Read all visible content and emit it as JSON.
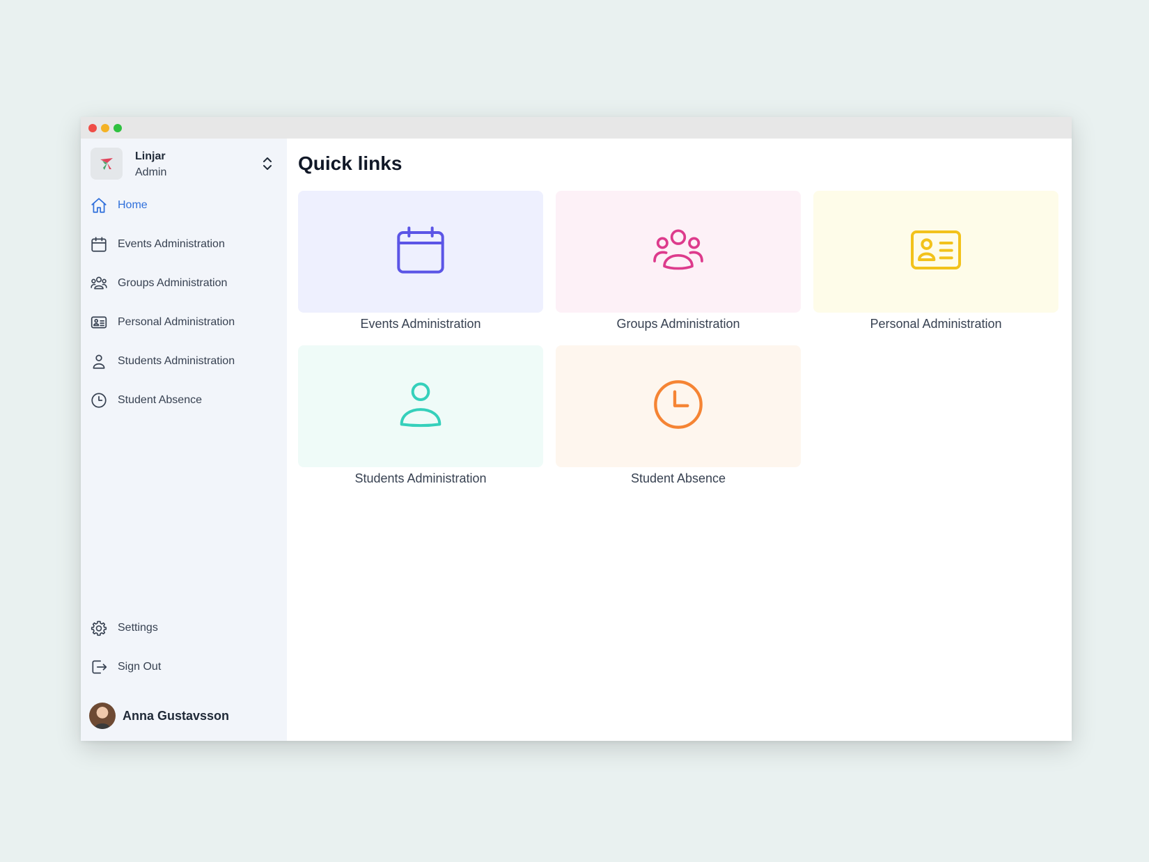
{
  "window": {
    "controls": [
      "close",
      "minimize",
      "maximize"
    ]
  },
  "sidebar": {
    "org": {
      "name": "Linjar",
      "role": "Admin",
      "logo_icon": "linjar-logo-icon",
      "switch_icon": "chevron-up-down-icon"
    },
    "items": [
      {
        "label": "Home",
        "icon": "home-icon",
        "active": true
      },
      {
        "label": "Events Administration",
        "icon": "calendar-icon",
        "active": false
      },
      {
        "label": "Groups Administration",
        "icon": "user-group-icon",
        "active": false
      },
      {
        "label": "Personal Administration",
        "icon": "id-card-icon",
        "active": false
      },
      {
        "label": "Students Administration",
        "icon": "user-icon",
        "active": false
      },
      {
        "label": "Student Absence",
        "icon": "clock-icon",
        "active": false
      }
    ],
    "bottom_items": [
      {
        "label": "Settings",
        "icon": "gear-icon"
      },
      {
        "label": "Sign Out",
        "icon": "sign-out-icon"
      }
    ],
    "user": {
      "name": "Anna Gustavsson"
    }
  },
  "main": {
    "title": "Quick links",
    "cards": [
      {
        "label": "Events Administration",
        "icon": "calendar-icon",
        "bg": "#eef0fe",
        "color": "#5b55e6"
      },
      {
        "label": "Groups Administration",
        "icon": "user-group-icon",
        "bg": "#fdf1f7",
        "color": "#dd3b8c"
      },
      {
        "label": "Personal Administration",
        "icon": "id-card-icon",
        "bg": "#fefce9",
        "color": "#f2c21b"
      },
      {
        "label": "Students Administration",
        "icon": "user-icon",
        "bg": "#effbf8",
        "color": "#35d0bb"
      },
      {
        "label": "Student Absence",
        "icon": "clock-icon",
        "bg": "#fef6ee",
        "color": "#f58434"
      }
    ]
  },
  "colors": {
    "accent": "#2f6fdb",
    "sidebar_bg": "#f2f5fa",
    "page_bg": "#e9f1f0"
  }
}
